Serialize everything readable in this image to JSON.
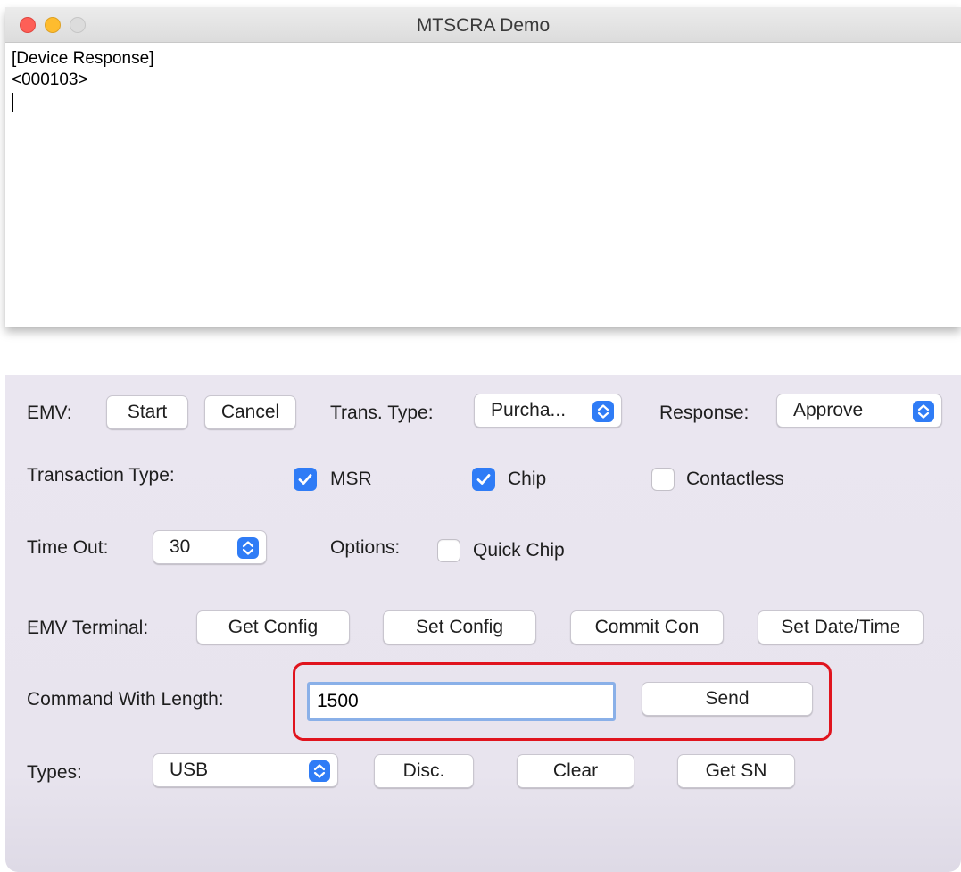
{
  "window": {
    "title": "MTSCRA Demo"
  },
  "log": {
    "lines": [
      "[Device Response]",
      "<000103>"
    ]
  },
  "emv": {
    "label": "EMV:",
    "start": "Start",
    "cancel": "Cancel",
    "trans_type_label": "Trans. Type:",
    "trans_type_value": "Purcha...",
    "response_label": "Response:",
    "response_value": "Approve"
  },
  "transaction_type": {
    "label": "Transaction Type:",
    "options": [
      {
        "label": "MSR",
        "checked": true
      },
      {
        "label": "Chip",
        "checked": true
      },
      {
        "label": "Contactless",
        "checked": false
      }
    ]
  },
  "timeout": {
    "label": "Time Out:",
    "value": "30",
    "options_label": "Options:",
    "quick_chip_label": "Quick Chip",
    "quick_chip_checked": false
  },
  "emv_terminal": {
    "label": "EMV Terminal:",
    "buttons": [
      "Get Config",
      "Set Config",
      "Commit Con",
      "Set Date/Time"
    ]
  },
  "command": {
    "label": "Command With Length:",
    "value": "1500",
    "send": "Send"
  },
  "types": {
    "label": "Types:",
    "value": "USB",
    "buttons": [
      "Disc.",
      "Clear",
      "Get SN"
    ]
  },
  "colors": {
    "accent": "#2f7cf6",
    "highlight": "#e0141e",
    "panel": "#e9e5ef"
  }
}
